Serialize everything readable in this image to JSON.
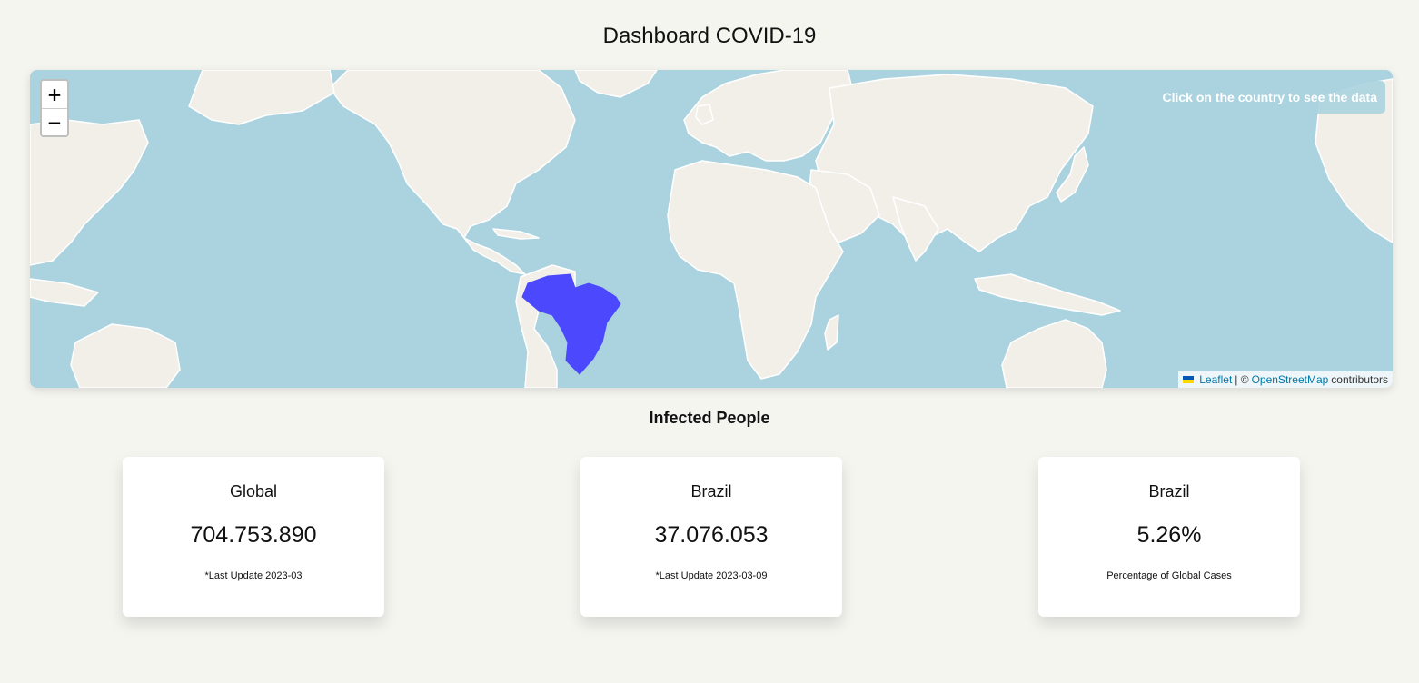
{
  "page": {
    "title": "Dashboard COVID-19"
  },
  "map": {
    "zoom_in": "+",
    "zoom_out": "−",
    "hint": "Click on the country to see the data",
    "highlight_country": "Brazil",
    "colors": {
      "ocean": "#aad3df",
      "land": "#f2efe9",
      "highlight": "#4b48fd"
    },
    "attribution": {
      "leaflet": "Leaflet",
      "separator": "| ©",
      "osm": "OpenStreetMap",
      "suffix": "contributors"
    }
  },
  "section": {
    "title": "Infected People"
  },
  "cards": [
    {
      "label": "Global",
      "value": "704.753.890",
      "note": "*Last Update 2023-03"
    },
    {
      "label": "Brazil",
      "value": "37.076.053",
      "note": "*Last Update 2023-03-09"
    },
    {
      "label": "Brazil",
      "value": "5.26%",
      "note": "Percentage of Global Cases"
    }
  ]
}
